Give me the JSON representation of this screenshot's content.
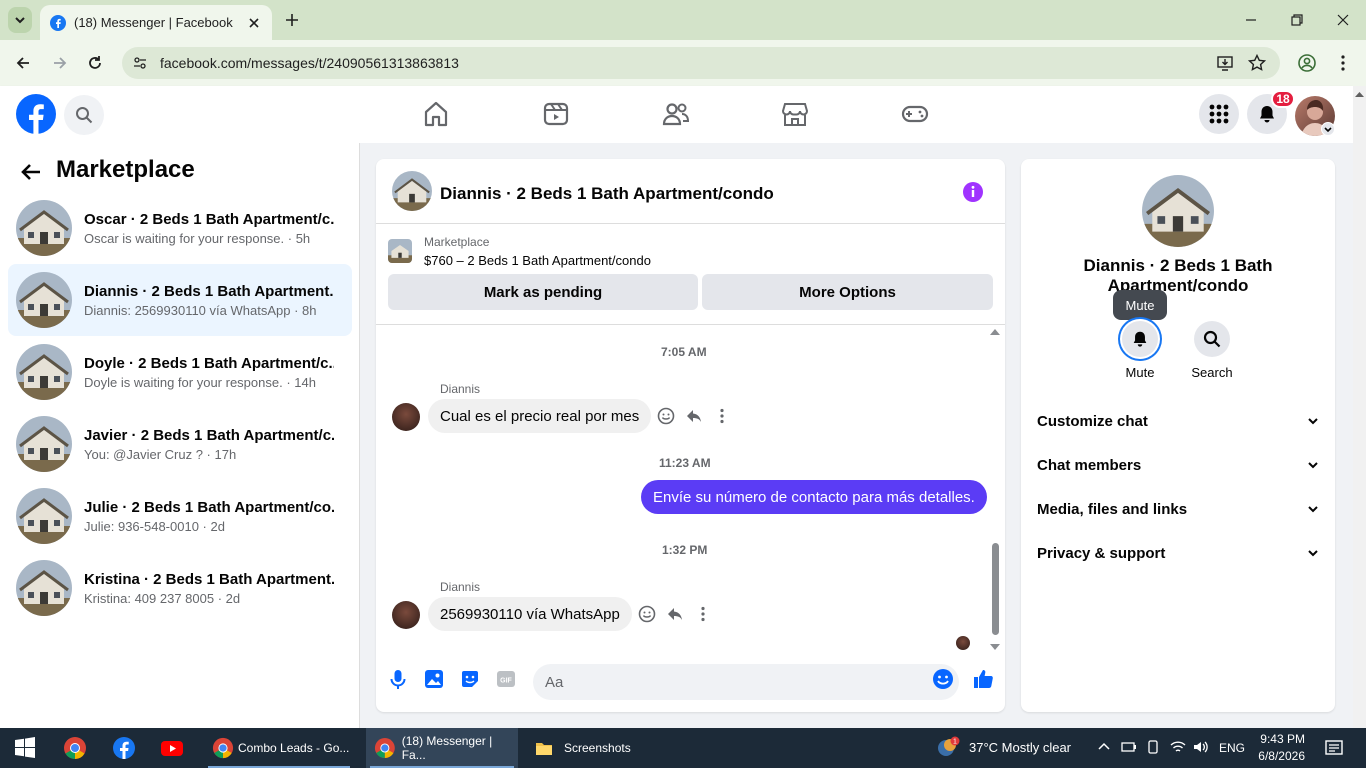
{
  "browser": {
    "tab_title": "(18) Messenger | Facebook",
    "url": "facebook.com/messages/t/24090561313863813"
  },
  "header": {
    "notification_count": "18",
    "nav_icons": [
      "home-icon",
      "video-icon",
      "friends-icon",
      "marketplace-icon",
      "gaming-icon"
    ]
  },
  "sidebar": {
    "title": "Marketplace",
    "conversations": [
      {
        "name": "Oscar · 2 Beds 1 Bath Apartment/c...",
        "preview": "Oscar is waiting for your response. · 5h"
      },
      {
        "name": "Diannis · 2 Beds 1 Bath Apartment...",
        "preview": "Diannis: 2569930110 vía WhatsApp · 8h"
      },
      {
        "name": "Doyle · 2 Beds 1 Bath Apartment/c...",
        "preview": "Doyle is waiting for your response. · 14h"
      },
      {
        "name": "Javier · 2 Beds 1 Bath Apartment/c...",
        "preview": "You: @Javier Cruz ? · 17h"
      },
      {
        "name": "Julie · 2 Beds 1 Bath Apartment/co...",
        "preview": "Julie: 936-548-0010 · 2d"
      },
      {
        "name": "Kristina · 2 Beds 1 Bath Apartment...",
        "preview": "Kristina: 409 237 8005 · 2d"
      }
    ]
  },
  "chat": {
    "title": "Diannis · 2 Beds 1 Bath Apartment/condo",
    "marketplace_label": "Marketplace",
    "listing": "$760 – 2 Beds 1 Bath Apartment/condo",
    "mark_pending": "Mark as pending",
    "more_options": "More Options",
    "messages": {
      "t1": "7:05 AM",
      "s1": "Diannis",
      "m1": "Cual es el precio real por mes",
      "t2": "11:23 AM",
      "m2": "Envíe su número de contacto para más detalles.",
      "t3": "1:32 PM",
      "s3": "Diannis",
      "m3": "2569930110 vía WhatsApp"
    },
    "input_placeholder": "Aa"
  },
  "details": {
    "name": "Diannis · 2 Beds 1 Bath Apartment/condo",
    "tooltip": "Mute",
    "mute_label": "Mute",
    "search_label": "Search",
    "sections": [
      "Customize chat",
      "Chat members",
      "Media, files and links",
      "Privacy & support"
    ]
  },
  "taskbar": {
    "apps": [
      "Combo Leads - Go...",
      "(18) Messenger | Fa...",
      "Screenshots"
    ],
    "weather": "37°C  Mostly clear",
    "lang": "ENG",
    "time": "9:43 PM",
    "date": "6/8/2026"
  },
  "colors": {
    "accent": "#5b3cf5",
    "fb_blue": "#1877f2",
    "purple_info": "#a033ff"
  }
}
